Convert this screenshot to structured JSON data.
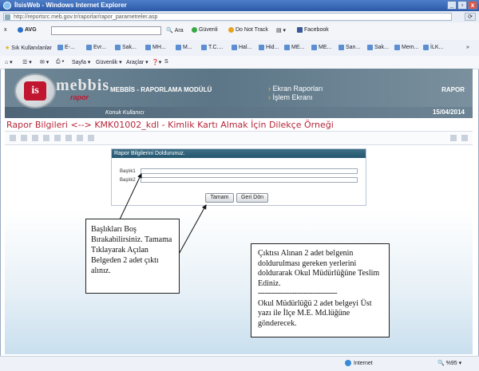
{
  "window": {
    "title": "İlsisWeb - Windows Internet Explorer",
    "minimize": "_",
    "restore": "▫",
    "close": "x"
  },
  "address": {
    "url": "http://reportsrc.meb.gov.tr/raporlar/rapor_parametreler.asp"
  },
  "avg_toolbar": {
    "close": "x",
    "brand": "AVG",
    "search_btn": "Ara",
    "safe": "Güvenli",
    "dnt": "Do Not Track",
    "facebook": "Facebook"
  },
  "favorites": {
    "label": "Sık Kullanılanlar",
    "items": [
      "E-...",
      "Evr...",
      "Sak...",
      "MH...",
      "M...",
      "T.C....",
      "Hal...",
      "Hid...",
      "ME...",
      "ME...",
      "San...",
      "Sak...",
      "Mem...",
      "İLK..."
    ]
  },
  "commandbar": {
    "page": "Sayfa",
    "security": "Güvenlik",
    "tools": "Araçlar"
  },
  "banner": {
    "logo_text": "mebbis",
    "logo_sub": "rapor",
    "logo_mark": "is",
    "module": "MEBBİS - RAPORLAMA MODÜLÜ",
    "user": "Konuk Kullanıcı",
    "link1": "Ekran Raporları",
    "link2": "İşlem Ekranı",
    "right_label": "RAPOR",
    "date": "15/04/2014"
  },
  "page": {
    "title": "Rapor Bilgileri <--> KMK01002_kdl - Kimlik Kartı Almak İçin Dilekçe Örneği"
  },
  "form": {
    "header": "Rapor Bilgilerini Doldurunuz.",
    "field1_label": "Başlık1",
    "field2_label": "Başlık2",
    "field1_value": "",
    "field2_value": "",
    "ok": "Tamam",
    "back": "Geri Dön"
  },
  "callout1": {
    "text": "Başlıkları Boş Bırakabilirsiniz. Tamama Tıklayarak Açılan Belgeden 2 adet çıktı alınız."
  },
  "callout2": {
    "line1": "Çıktısı Alınan 2 adet belgenin doldurulması gereken yerlerini doldurarak Okul Müdürlüğüne Teslim Ediniz.",
    "separator": "-----------------------------------",
    "line2": "Okul Müdürlüğü 2 adet belgeyi Üst yazı ile İlçe M.E. Md.lüğüne gönderecek."
  },
  "status": {
    "zone": "Internet",
    "zoom": "%95"
  },
  "colors": {
    "title_red": "#b5273a",
    "panel_head": "#23566f",
    "banner": "#6f8797"
  }
}
